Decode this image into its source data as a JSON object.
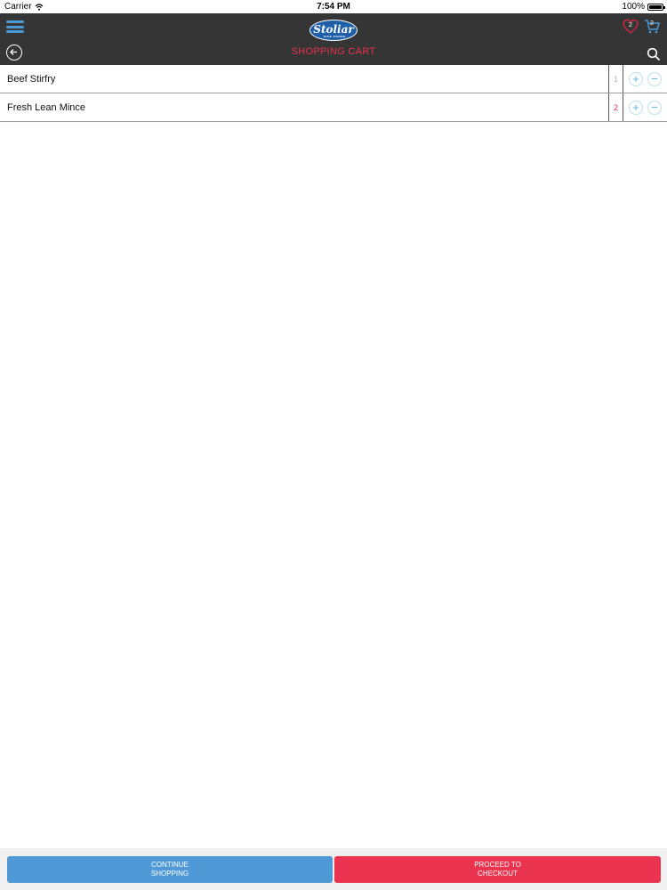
{
  "status_bar": {
    "carrier": "Carrier",
    "time": "7:54 PM",
    "battery": "100%"
  },
  "header": {
    "logo_text": "Stoliar",
    "logo_subtext": "FINE FOODS",
    "title": "SHOPPING CART",
    "favorites_count": "2",
    "cart_count": "2",
    "accent_color": "#e8314d",
    "icons": [
      "menu-icon",
      "back-icon",
      "heart-icon",
      "cart-icon",
      "search-icon"
    ]
  },
  "cart": {
    "items": [
      {
        "name": "Beef Stirfry",
        "quantity": "1"
      },
      {
        "name": "Fresh Lean Mince",
        "quantity": "2"
      }
    ],
    "plus_symbol": "+",
    "minus_symbol": "−"
  },
  "footer": {
    "continue_label": "CONTINUE\nSHOPPING",
    "checkout_label": "PROCEED TO\nCHECKOUT",
    "continue_color": "#4f9ad6",
    "checkout_color": "#ea3450"
  }
}
